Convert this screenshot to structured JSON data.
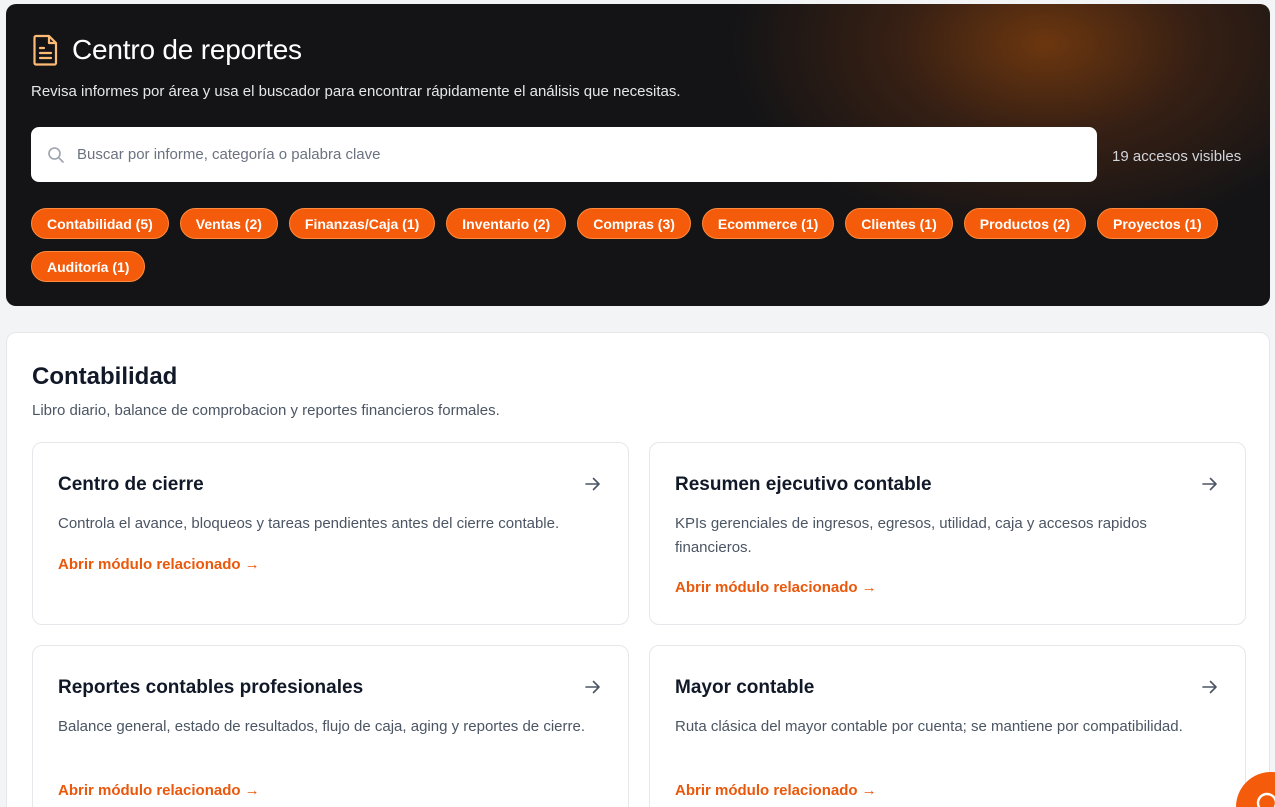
{
  "header": {
    "title": "Centro de reportes",
    "icon": "document-icon",
    "subtitle": "Revisa informes por área y usa el buscador para encontrar rápidamente el análisis que necesitas.",
    "search": {
      "placeholder": "Buscar por informe, categoría o palabra clave",
      "value": ""
    },
    "visible_count": "19 accesos visibles",
    "categories": [
      "Contabilidad (5)",
      "Ventas (2)",
      "Finanzas/Caja (1)",
      "Inventario (2)",
      "Compras (3)",
      "Ecommerce (1)",
      "Clientes (1)",
      "Productos (2)",
      "Proyectos (1)",
      "Auditoría (1)"
    ]
  },
  "section": {
    "title": "Contabilidad",
    "subtitle": "Libro diario, balance de comprobacion y reportes financieros formales.",
    "cards": [
      {
        "title": "Centro de cierre",
        "description": "Controla el avance, bloqueos y tareas pendientes antes del cierre contable.",
        "link": "Abrir módulo relacionado →"
      },
      {
        "title": "Resumen ejecutivo contable",
        "description": "KPIs gerenciales de ingresos, egresos, utilidad, caja y accesos rapidos financieros.",
        "link": "Abrir módulo relacionado →"
      },
      {
        "title": "Reportes contables profesionales",
        "description": "Balance general, estado de resultados, flujo de caja, aging y reportes de cierre.",
        "link": "Abrir módulo relacionado →"
      },
      {
        "title": "Mayor contable",
        "description": "Ruta clásica del mayor contable por cuenta; se mantiene por compatibilidad.",
        "link": "Abrir módulo relacionado →"
      }
    ]
  },
  "colors": {
    "accent": "#f45b0a",
    "link": "#ea580c",
    "hero_bg": "#141416"
  }
}
